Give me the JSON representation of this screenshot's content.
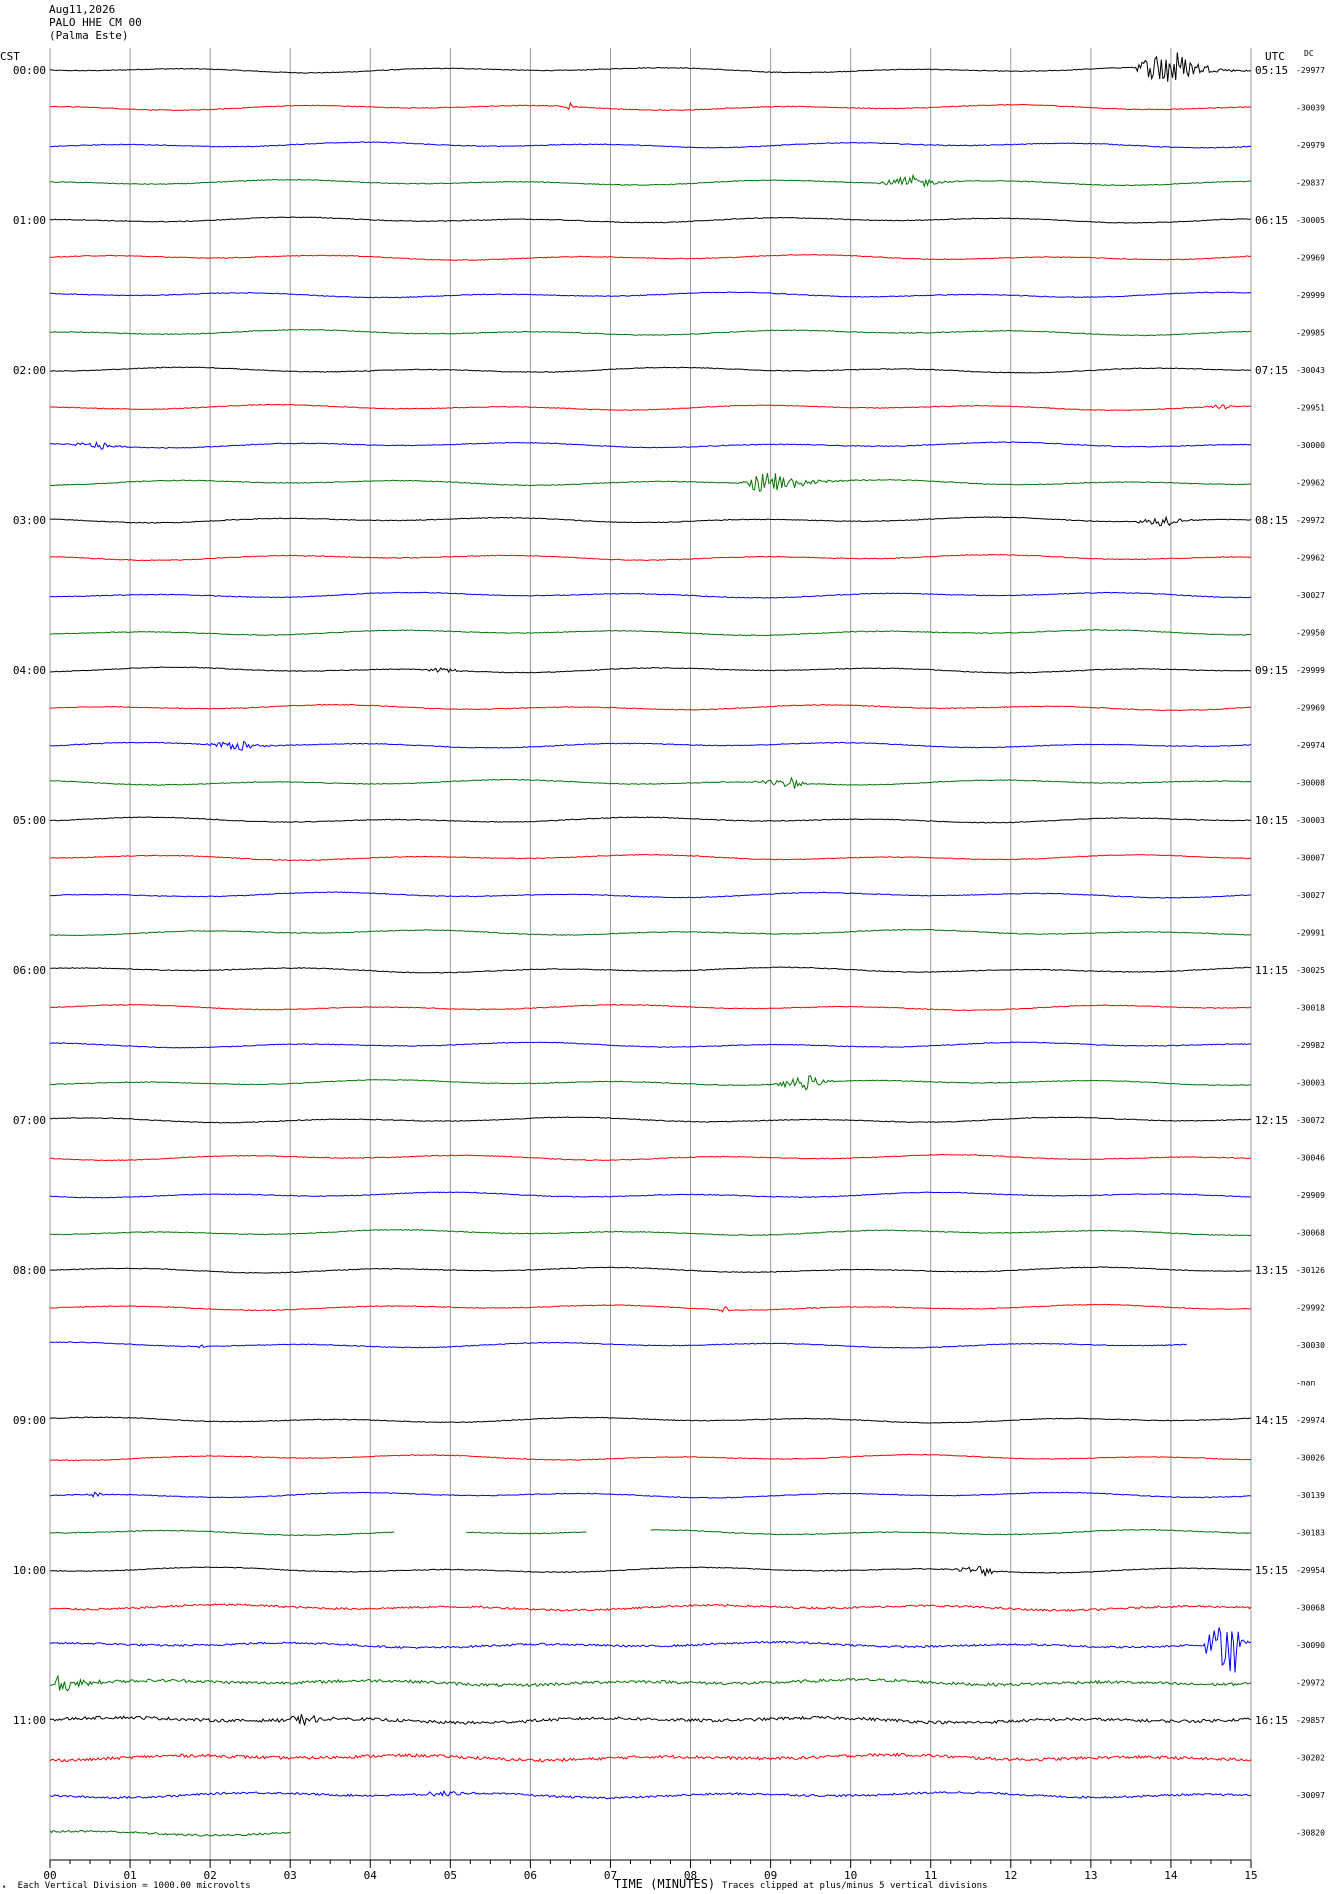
{
  "header": {
    "date": "Aug11,2026",
    "station": "PALO HHE CM 00",
    "location": "(Palma Este)"
  },
  "left_axis_label": "CST",
  "right_axis_label": "UTC",
  "dc_label": "DC",
  "footer": {
    "scale_note": "Each Vertical Division = 1000.00 microvolts",
    "xlabel": "TIME (MINUTES)",
    "clip_note": "Traces clipped at plus/minus 5 vertical divisions"
  },
  "colors": {
    "cycle": [
      "#000000",
      "#ff0000",
      "#0000ff",
      "#007700"
    ],
    "grid": "#999999"
  },
  "chart_data": {
    "type": "line",
    "title": "",
    "xlabel": "TIME (MINUTES)",
    "xlim": [
      0,
      15
    ],
    "x_ticks": [
      "00",
      "01",
      "02",
      "03",
      "04",
      "05",
      "06",
      "07",
      "08",
      "09",
      "10",
      "11",
      "12",
      "13",
      "14",
      "15"
    ],
    "grid": true,
    "rows": [
      {
        "cst": "00:00",
        "utc": "05:15",
        "dc": "-29977",
        "events": [
          {
            "t": 13.5,
            "dur": 1.5,
            "amp": 24,
            "peak": 14.0
          }
        ]
      },
      {
        "dc": "-30039",
        "events": [
          {
            "t": 6.4,
            "dur": 0.2,
            "amp": 4
          }
        ]
      },
      {
        "dc": "-29979",
        "events": []
      },
      {
        "dc": "-29837",
        "events": [
          {
            "t": 10.3,
            "dur": 1.3,
            "amp": 8,
            "peak": 10.8
          }
        ]
      },
      {
        "cst": "01:00",
        "utc": "06:15",
        "dc": "-30005",
        "events": []
      },
      {
        "dc": "-29969",
        "events": []
      },
      {
        "dc": "-29999",
        "events": []
      },
      {
        "dc": "-29985",
        "events": []
      },
      {
        "cst": "02:00",
        "utc": "07:15",
        "dc": "-30043",
        "events": []
      },
      {
        "dc": "-29951",
        "events": [
          {
            "t": 14.4,
            "dur": 0.6,
            "amp": 3
          }
        ]
      },
      {
        "dc": "-30000",
        "events": [
          {
            "t": 0.2,
            "dur": 0.9,
            "amp": 4
          }
        ]
      },
      {
        "dc": "-29962",
        "events": [
          {
            "t": 8.6,
            "dur": 1.6,
            "amp": 14,
            "peak": 9.0
          }
        ]
      },
      {
        "cst": "03:00",
        "utc": "08:15",
        "dc": "-29972",
        "events": [
          {
            "t": 13.5,
            "dur": 1.0,
            "amp": 6,
            "peak": 13.95
          }
        ]
      },
      {
        "dc": "-29962",
        "events": []
      },
      {
        "dc": "-30027",
        "events": []
      },
      {
        "dc": "-29950",
        "events": []
      },
      {
        "cst": "04:00",
        "utc": "09:15",
        "dc": "-29999",
        "events": [
          {
            "t": 4.6,
            "dur": 0.8,
            "amp": 3
          }
        ]
      },
      {
        "dc": "-29969",
        "events": []
      },
      {
        "dc": "-29974",
        "events": [
          {
            "t": 1.9,
            "dur": 1.1,
            "amp": 6,
            "peak": 2.4
          }
        ]
      },
      {
        "dc": "-30008",
        "events": [
          {
            "t": 8.7,
            "dur": 0.9,
            "amp": 6,
            "peak": 9.3
          }
        ]
      },
      {
        "cst": "05:00",
        "utc": "10:15",
        "dc": "-30003",
        "events": []
      },
      {
        "dc": "-30007",
        "events": []
      },
      {
        "dc": "-30027",
        "events": []
      },
      {
        "dc": "-29991",
        "events": []
      },
      {
        "cst": "06:00",
        "utc": "11:15",
        "dc": "-30025",
        "events": []
      },
      {
        "dc": "-30018",
        "events": []
      },
      {
        "dc": "-29982",
        "events": []
      },
      {
        "dc": "-30003",
        "events": [
          {
            "t": 9.0,
            "dur": 1.0,
            "amp": 8,
            "peak": 9.5
          }
        ]
      },
      {
        "cst": "07:00",
        "utc": "12:15",
        "dc": "-30072",
        "events": []
      },
      {
        "dc": "-30046",
        "events": []
      },
      {
        "dc": "-29909",
        "events": []
      },
      {
        "dc": "-30068",
        "events": []
      },
      {
        "cst": "08:00",
        "utc": "13:15",
        "dc": "-30126",
        "events": []
      },
      {
        "dc": "-29992",
        "events": [
          {
            "t": 8.3,
            "dur": 0.3,
            "amp": 4
          }
        ]
      },
      {
        "dc": "-30030",
        "end": 14.2,
        "events": [
          {
            "t": 1.7,
            "dur": 0.4,
            "amp": 2
          }
        ]
      },
      {
        "dc": "-nan",
        "gap": true,
        "events": []
      },
      {
        "cst": "09:00",
        "utc": "14:15",
        "dc": "-29974",
        "events": []
      },
      {
        "dc": "-30026",
        "events": []
      },
      {
        "dc": "-30139",
        "events": [
          {
            "t": 0.4,
            "dur": 0.4,
            "amp": 4
          }
        ]
      },
      {
        "dc": "-30183",
        "segments": [
          [
            0,
            4.3
          ],
          [
            5.2,
            6.7
          ],
          [
            7.5,
            15
          ]
        ],
        "events": []
      },
      {
        "cst": "10:00",
        "utc": "15:15",
        "dc": "-29954",
        "events": [
          {
            "t": 11.2,
            "dur": 0.8,
            "amp": 6,
            "peak": 11.7
          }
        ]
      },
      {
        "dc": "-30068",
        "noisy": 2,
        "events": [
          {
            "t": 11.3,
            "dur": 0.2,
            "amp": 3
          }
        ]
      },
      {
        "dc": "-30090",
        "noisy": 2,
        "events": [
          {
            "t": 14.3,
            "dur": 0.7,
            "amp": 32,
            "peak": 14.8
          }
        ]
      },
      {
        "dc": "-29972",
        "noisy": 3,
        "events": [
          {
            "t": 0.0,
            "dur": 1.0,
            "amp": 10,
            "peak": 0.1
          }
        ]
      },
      {
        "cst": "11:00",
        "utc": "16:15",
        "dc": "-29857",
        "noisy": 3,
        "events": [
          {
            "t": 2.8,
            "dur": 0.8,
            "amp": 6,
            "peak": 3.2
          }
        ]
      },
      {
        "dc": "-30202",
        "noisy": 3,
        "events": []
      },
      {
        "dc": "-30097",
        "noisy": 2,
        "events": [
          {
            "t": 4.5,
            "dur": 1.0,
            "amp": 3
          }
        ]
      },
      {
        "dc": "-30820",
        "end": 3.0,
        "noisy": 2,
        "events": []
      }
    ]
  }
}
